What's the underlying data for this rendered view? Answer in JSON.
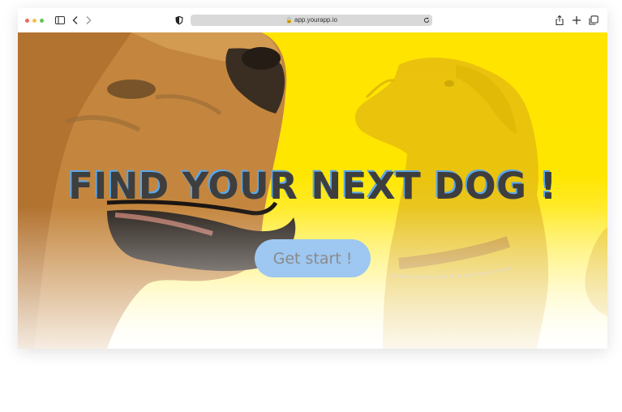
{
  "browser": {
    "url": "app.yourapp.io",
    "traffic_colors": [
      "#ec6a5e",
      "#f4bf4f",
      "#61c554"
    ]
  },
  "hero": {
    "title": "FIND YOUR NEXT DOG !",
    "cta_label": "Get start !",
    "background_color": "#ffe400",
    "title_color": "#3e3e3e",
    "title_shadow_color": "#5aa7ea",
    "cta_color": "#9ec7f1"
  }
}
